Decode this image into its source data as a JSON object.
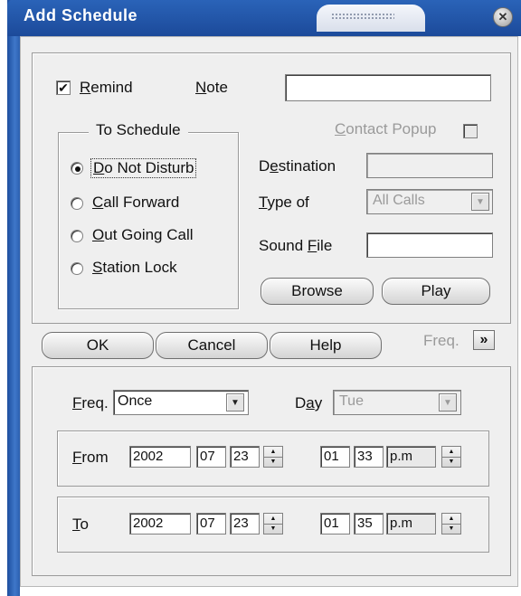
{
  "window": {
    "title": "Add Schedule",
    "close_glyph": "✕"
  },
  "reminder": {
    "remind_checked": true,
    "remind_label": "Remind",
    "note_label": "Note",
    "note_value": ""
  },
  "to_schedule": {
    "group_label": "To Schedule",
    "options": [
      {
        "label": "Do Not Disturb",
        "selected": true
      },
      {
        "label": "Call Forward",
        "selected": false
      },
      {
        "label": "Out Going Call",
        "selected": false
      },
      {
        "label": "Station Lock",
        "selected": false
      }
    ]
  },
  "contact_popup": {
    "label": "Contact Popup",
    "checked": false,
    "enabled": false
  },
  "destination": {
    "label": "Destination",
    "value": ""
  },
  "type_of": {
    "label": "Type of",
    "selected": "All Calls"
  },
  "sound_file": {
    "label": "Sound File",
    "value": ""
  },
  "buttons": {
    "browse": "Browse",
    "play": "Play",
    "ok": "OK",
    "cancel": "Cancel",
    "help": "Help",
    "freq_toggle": "Freq.",
    "freq_toggle_arrow": "»"
  },
  "frequency": {
    "freq_label": "Freq.",
    "freq_value": "Once",
    "day_label": "Day",
    "day_value": "Tue"
  },
  "from": {
    "label": "From",
    "year": "2002",
    "month": "07",
    "day": "23",
    "hour": "01",
    "minute": "33",
    "ampm": "p.m"
  },
  "to": {
    "label": "To",
    "year": "2002",
    "month": "07",
    "day": "23",
    "hour": "01",
    "minute": "35",
    "ampm": "p.m"
  },
  "colors": {
    "title_bar": "#1c4a9a",
    "panel_bg": "#efefef",
    "disabled_text": "#9a9a9a"
  },
  "icons": {
    "close": "close-icon",
    "dropdown": "chevron-down-icon",
    "spin_up": "spin-up-icon",
    "spin_down": "spin-down-icon",
    "double_chevron": "double-chevron-right-icon"
  }
}
